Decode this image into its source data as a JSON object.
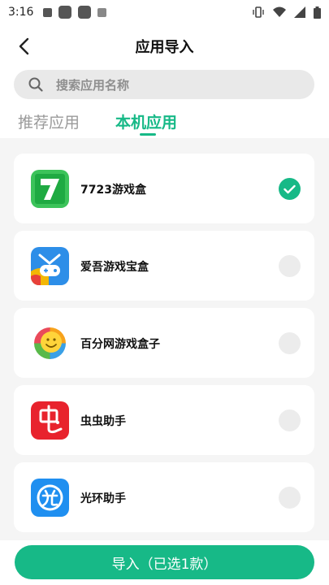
{
  "status_bar": {
    "time": "3:16"
  },
  "header": {
    "title": "应用导入"
  },
  "search": {
    "placeholder": "搜索应用名称"
  },
  "tabs": [
    {
      "label": "推荐应用",
      "active": false
    },
    {
      "label": "本机应用",
      "active": true
    }
  ],
  "apps": [
    {
      "name": "7723游戏盒",
      "icon": "7723-app-icon",
      "selected": true
    },
    {
      "name": "爱吾游戏宝盒",
      "icon": "aiwu-app-icon",
      "selected": false
    },
    {
      "name": "百分网游戏盒子",
      "icon": "baifen-app-icon",
      "selected": false
    },
    {
      "name": "虫虫助手",
      "icon": "chongchong-app-icon",
      "selected": false
    },
    {
      "name": "光环助手",
      "icon": "guanghuan-app-icon",
      "selected": false
    }
  ],
  "footer": {
    "import_label": "导入（已选1款）"
  },
  "colors": {
    "accent": "#17b987",
    "search_bg": "#e9e9e9",
    "list_bg": "#f5f5f5"
  }
}
